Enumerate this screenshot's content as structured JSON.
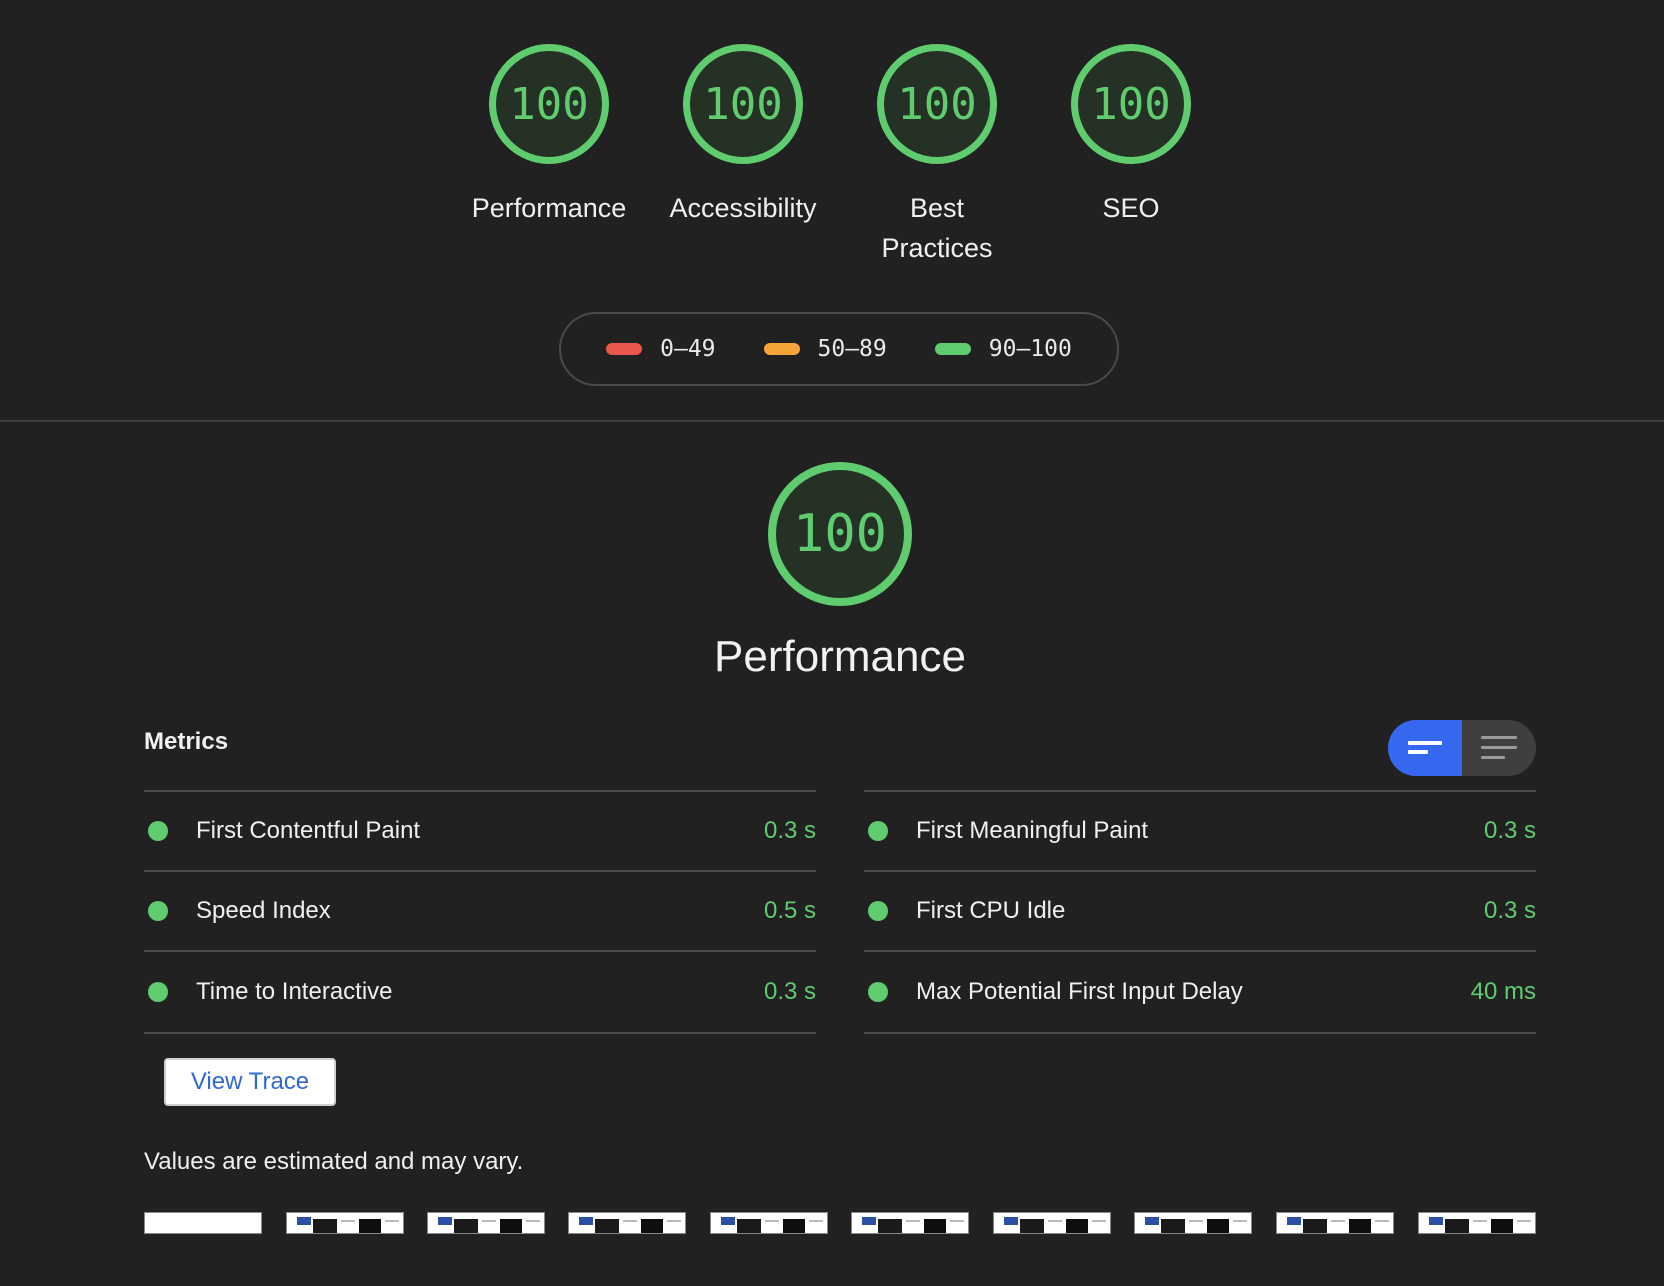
{
  "categories": [
    {
      "score": "100",
      "label": "Performance"
    },
    {
      "score": "100",
      "label": "Accessibility"
    },
    {
      "score": "100",
      "label": "Best Practices"
    },
    {
      "score": "100",
      "label": "SEO"
    }
  ],
  "legend": [
    {
      "range": "0–49",
      "color": "#e9574d"
    },
    {
      "range": "50–89",
      "color": "#f5a43a"
    },
    {
      "range": "90–100",
      "color": "#5fcd6f"
    }
  ],
  "performance": {
    "score": "100",
    "title": "Performance"
  },
  "metrics": {
    "header": "Metrics",
    "left": [
      {
        "name": "First Contentful Paint",
        "value": "0.3 s"
      },
      {
        "name": "Speed Index",
        "value": "0.5 s"
      },
      {
        "name": "Time to Interactive",
        "value": "0.3 s"
      }
    ],
    "right": [
      {
        "name": "First Meaningful Paint",
        "value": "0.3 s"
      },
      {
        "name": "First CPU Idle",
        "value": "0.3 s"
      },
      {
        "name": "Max Potential First Input Delay",
        "value": "40 ms"
      }
    ],
    "good_color": "#5fcd6f",
    "toggle_active_color": "#3568ee"
  },
  "view_trace_label": "View Trace",
  "estimate_note": "Values are estimated and may vary.",
  "filmstrip_icon": "screenshot-thumbnail-icon"
}
